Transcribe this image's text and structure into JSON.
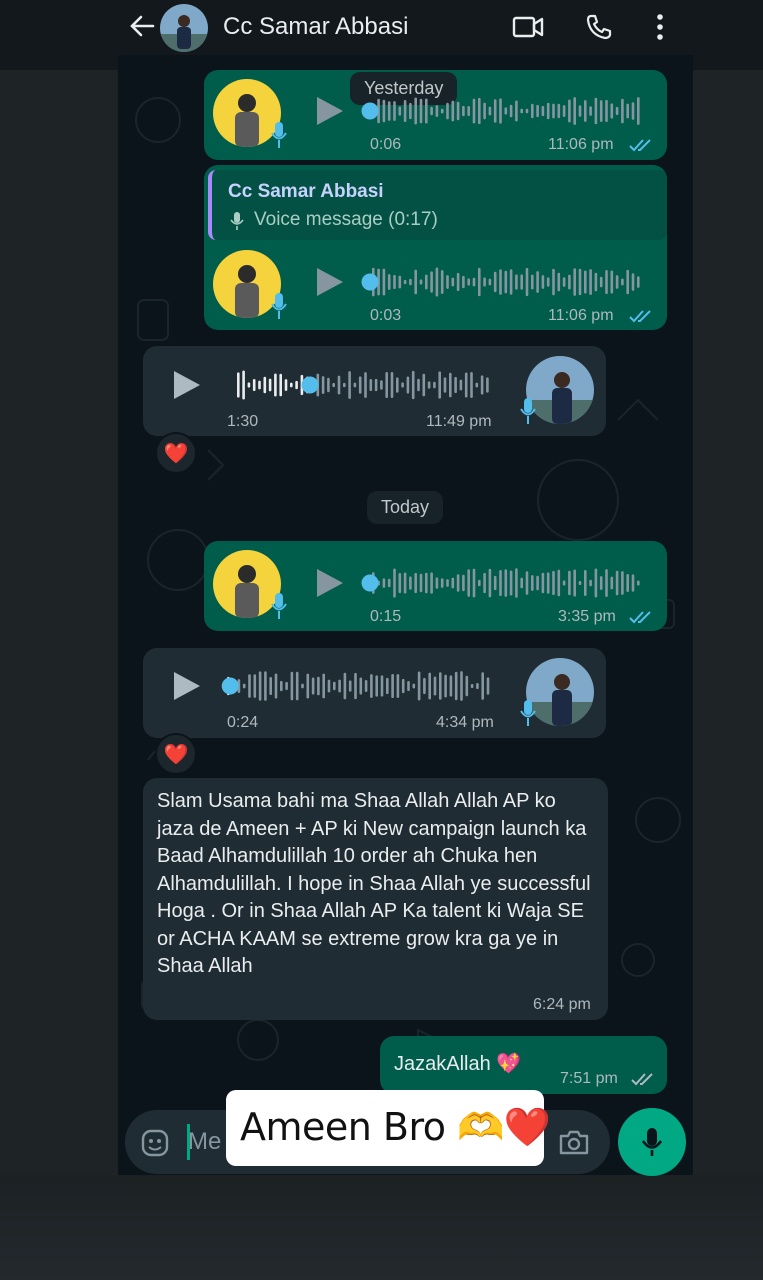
{
  "header": {
    "contact_name": "Cc Samar Abbasi",
    "icons": [
      "back-arrow-icon",
      "video-call-icon",
      "phone-icon",
      "more-vert-icon"
    ]
  },
  "date_separators": {
    "yesterday": "Yesterday",
    "today": "Today"
  },
  "messages": [
    {
      "type": "voice",
      "direction": "outgoing",
      "duration": "0:06",
      "time": "11:06 pm",
      "status": "read"
    },
    {
      "type": "voice",
      "direction": "outgoing",
      "duration": "0:03",
      "time": "11:06 pm",
      "status": "read",
      "reply_to": {
        "name": "Cc Samar Abbasi",
        "text": "Voice message (0:17)"
      }
    },
    {
      "type": "voice",
      "direction": "incoming",
      "duration": "1:30",
      "time": "11:49 pm",
      "reaction": "❤️"
    },
    {
      "type": "voice",
      "direction": "outgoing",
      "duration": "0:15",
      "time": "3:35 pm",
      "status": "read"
    },
    {
      "type": "voice",
      "direction": "incoming",
      "duration": "0:24",
      "time": "4:34 pm",
      "reaction": "❤️"
    },
    {
      "type": "text",
      "direction": "incoming",
      "text": "Slam Usama bahi ma Shaa Allah Allah AP ko jaza de Ameen + AP ki New campaign launch ka Baad Alhamdulillah 10 order ah Chuka hen Alhamdulillah. I hope in Shaa Allah ye successful Hoga . Or in Shaa Allah AP Ka talent ki Waja SE or ACHA KAAM se extreme grow kra ga ye in Shaa Allah",
      "time": "6:24 pm"
    },
    {
      "type": "text",
      "direction": "outgoing",
      "text": "JazakAllah 💖",
      "time": "7:51 pm",
      "status": "delivered"
    }
  ],
  "composer": {
    "placeholder": "Me"
  },
  "sticker_overlay": {
    "text": "Ameen Bro 🫶❤️"
  },
  "colors": {
    "outgoing": "#005c4b",
    "incoming": "#202c33",
    "accent": "#00a884",
    "read_tick": "#53bdeb"
  }
}
